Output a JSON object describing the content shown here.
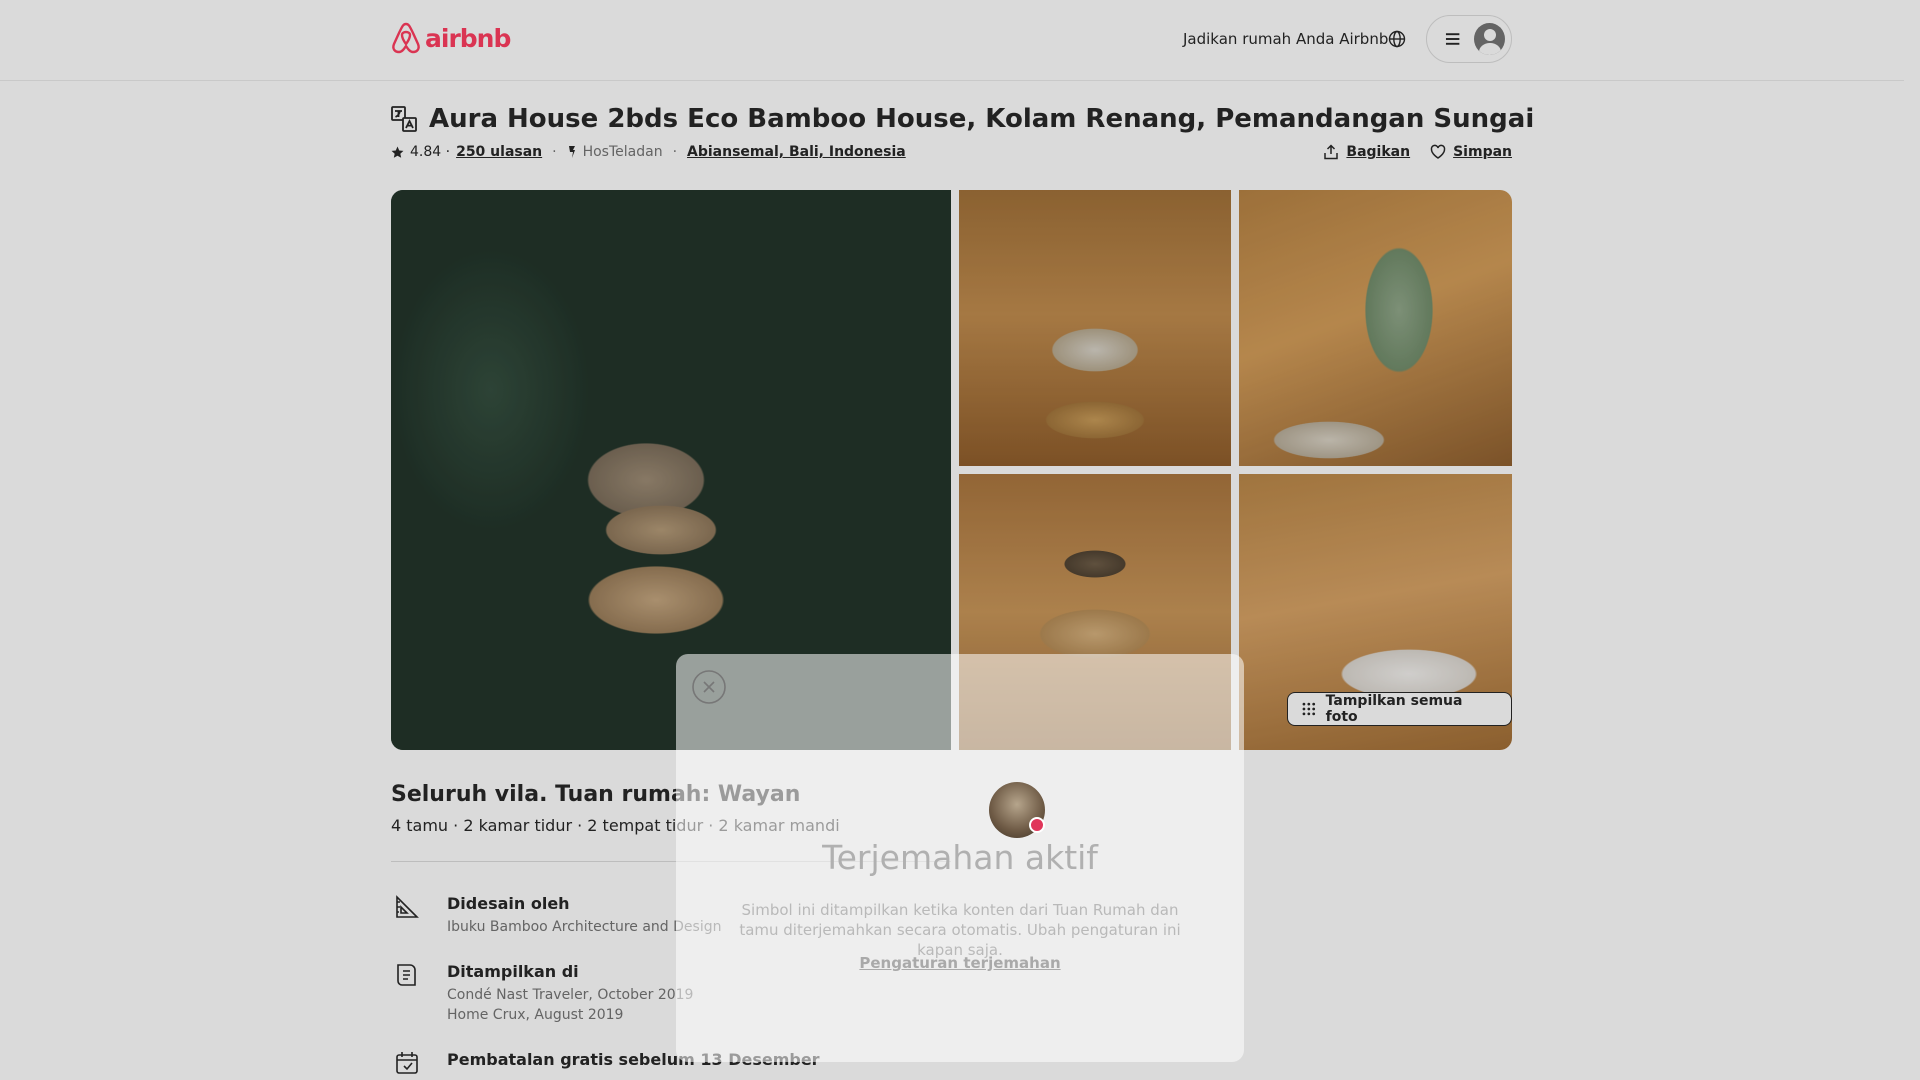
{
  "header": {
    "logo_text": "airbnb",
    "brand_color": "#FF385C",
    "host_link": "Jadikan rumah Anda Airbnb",
    "globe_icon": "globe-icon",
    "menu_icon": "hamburger-icon",
    "avatar_icon": "user-avatar-icon"
  },
  "listing": {
    "title": "Aura House 2bds Eco Bamboo House, Kolam Renang, Pemandangan Sungai",
    "rating": "4.84 ·",
    "reviews": "250 ulasan",
    "host_badge": "HosTeladan",
    "location": "Abiansemal, Bali, Indonesia",
    "share_label": "Bagikan",
    "save_label": "Simpan"
  },
  "gallery": {
    "show_all_label": "Tampilkan semua foto"
  },
  "details": {
    "heading": "Seluruh vila. Tuan rumah: Wayan",
    "summary": "4 tamu · 2 kamar tidur · 2 tempat tidur · 2 kamar mandi",
    "features": [
      {
        "title": "Didesain oleh",
        "lines": [
          "Ibuku Bamboo Architecture and Design"
        ]
      },
      {
        "title": "Ditampilkan di",
        "lines": [
          "Condé Nast Traveler, October 2019",
          "Home Crux, August 2019"
        ]
      },
      {
        "title": "Pembatalan gratis sebelum 13 Desember",
        "lines": []
      }
    ]
  },
  "modal": {
    "title": "Terjemahan aktif",
    "body": "Simbol ini ditampilkan ketika konten dari Tuan Rumah dan tamu diterjemahkan secara otomatis. Ubah pengaturan ini kapan saja.",
    "link": "Pengaturan terjemahan"
  }
}
